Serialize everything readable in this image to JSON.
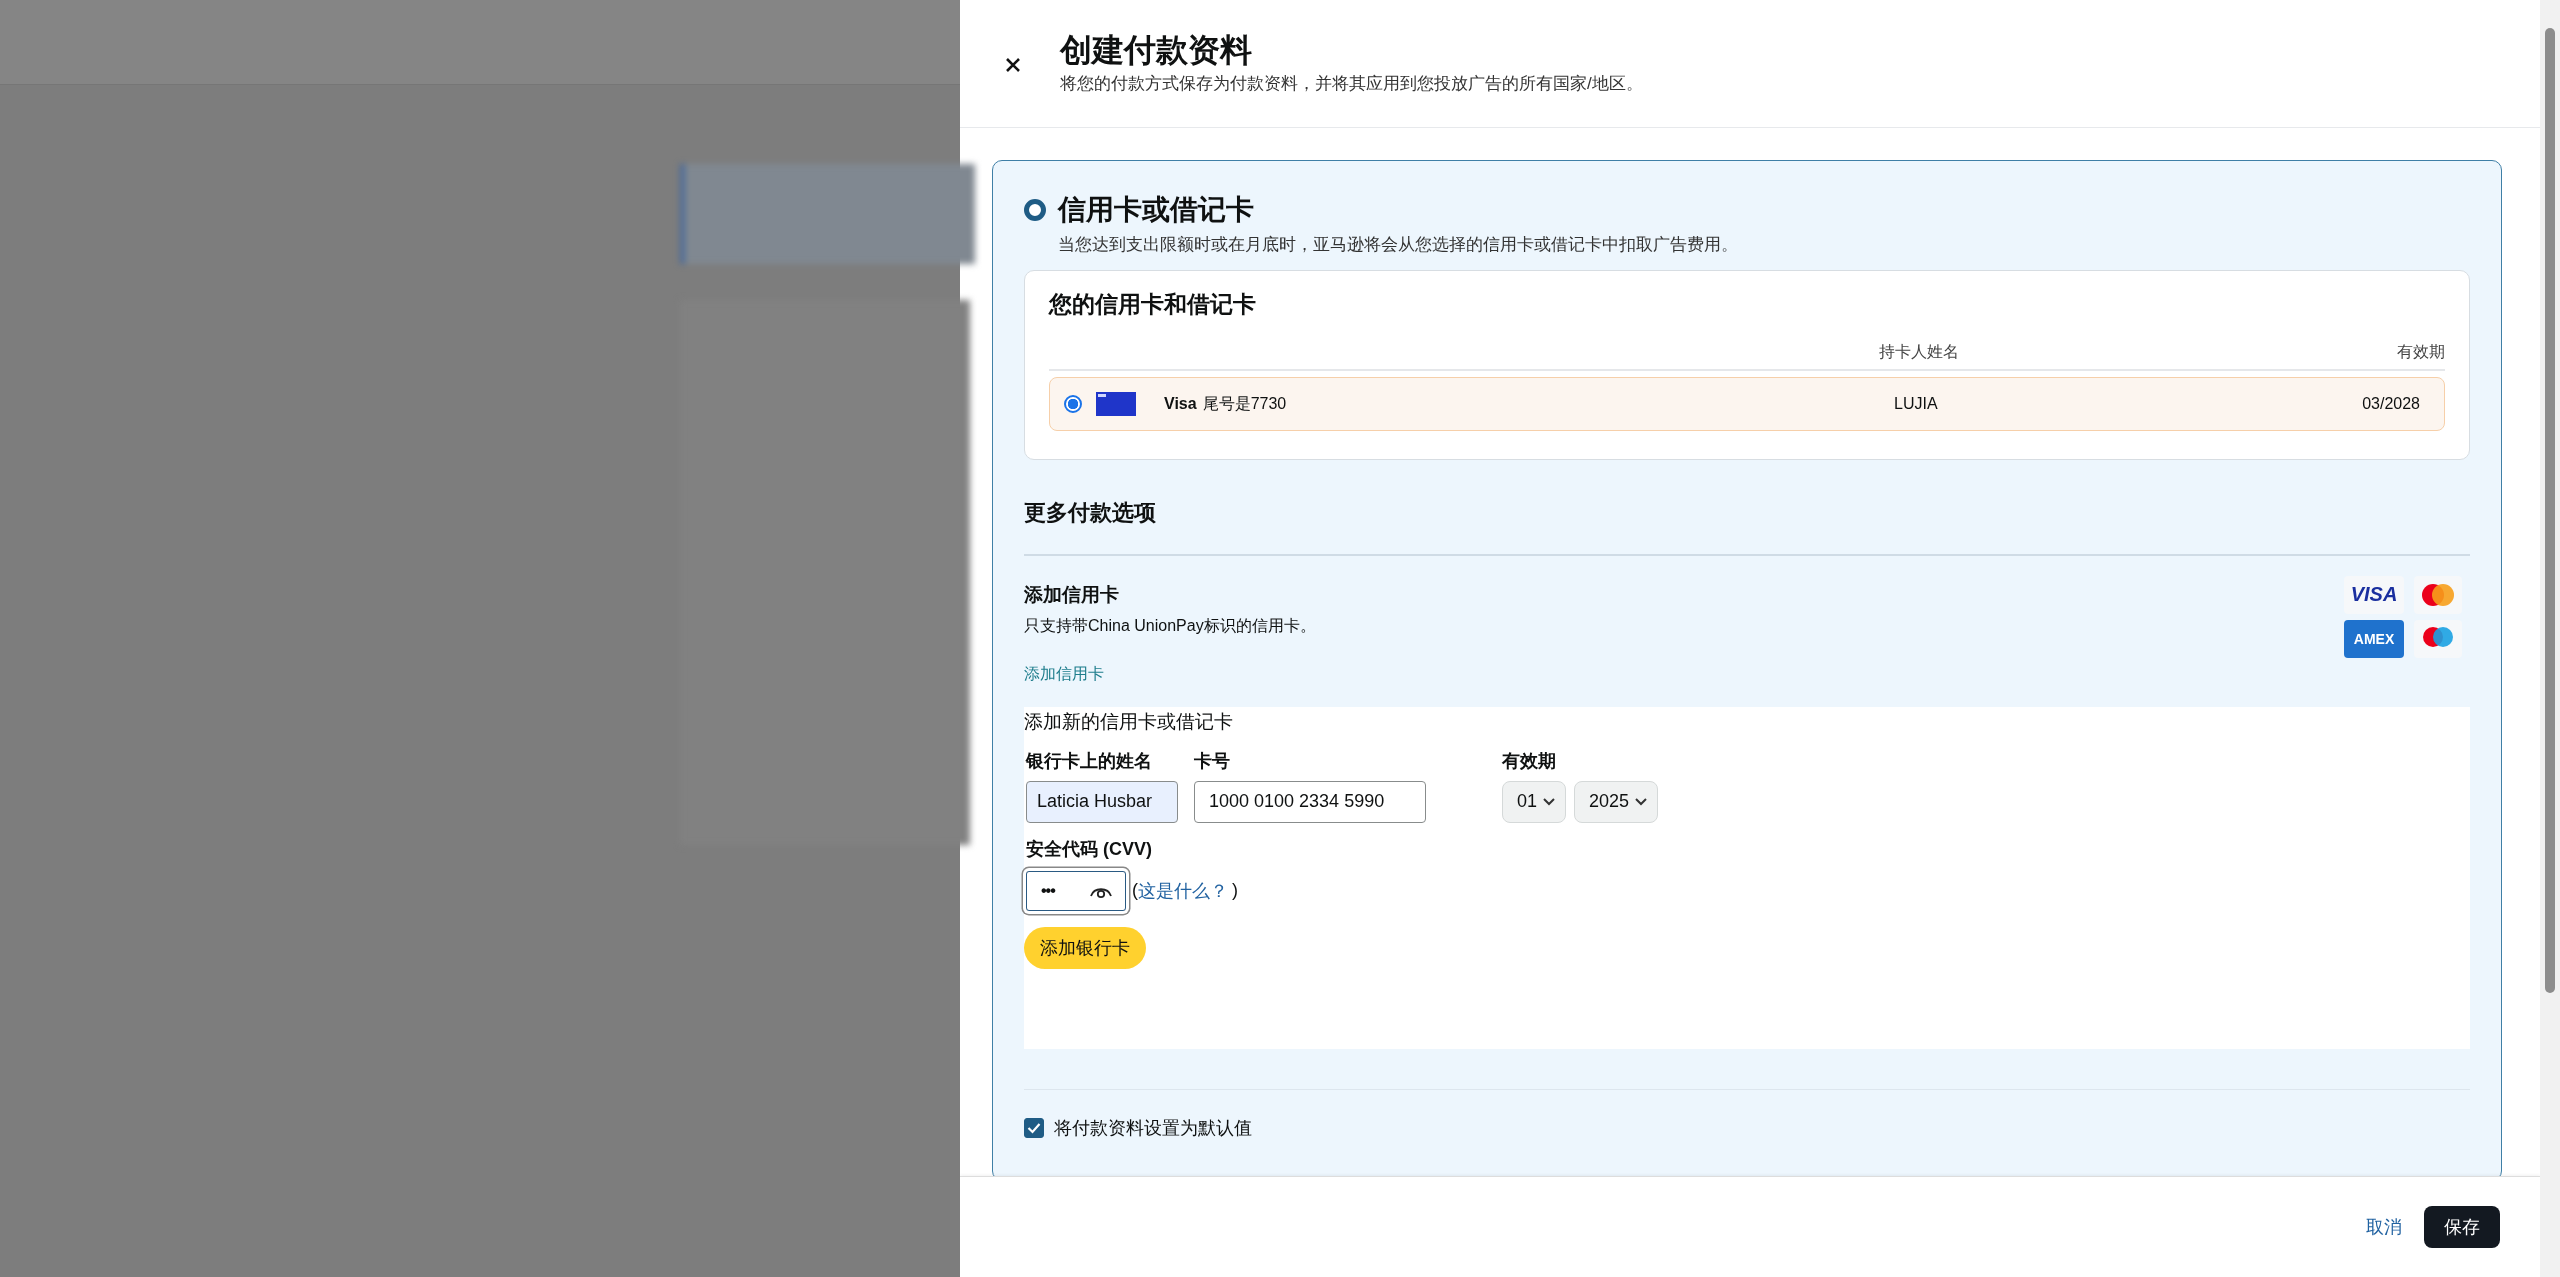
{
  "panel": {
    "title": "创建付款资料",
    "subtitle": "将您的付款方式保存为付款资料，并将其应用到您投放广告的所有国家/地区。"
  },
  "payment_method": {
    "label": "信用卡或借记卡",
    "selected": true,
    "description": "当您达到支出限额时或在月底时，亚马逊将会从您选择的信用卡或借记卡中扣取广告费用。"
  },
  "saved_cards": {
    "title": "您的信用卡和借记卡",
    "columns": [
      "持卡人姓名",
      "有效期"
    ],
    "rows": [
      {
        "selected": true,
        "brand": "Visa",
        "ending": "尾号是7730",
        "holder": "LUJIA",
        "expiry": "03/2028"
      }
    ]
  },
  "more_options": {
    "title": "更多付款选项",
    "add_card_title": "添加信用卡",
    "note": "只支持带China UnionPay标识的信用卡。",
    "link": "添加信用卡",
    "card_logos": [
      {
        "kind": "visa",
        "text": "VISA"
      },
      {
        "kind": "mastercard"
      },
      {
        "kind": "amex",
        "text": "AMEX"
      },
      {
        "kind": "maestro"
      }
    ]
  },
  "new_card_form": {
    "title": "添加新的信用卡或借记卡",
    "name_label": "银行卡上的姓名",
    "name_value": "Laticia Husbar",
    "number_label": "卡号",
    "number_value": "1000 0100 2334 5990",
    "expiry_label": "有效期",
    "month": "01",
    "year": "2025",
    "cvv_label": "安全代码 (CVV)",
    "cvv_value": "•••",
    "help_open": "(",
    "help_link": "这是什么？",
    "help_close": ")",
    "submit": "添加银行卡"
  },
  "default_checkbox": {
    "label": "将付款资料设置为默认值",
    "checked": true
  },
  "footer": {
    "cancel": "取消",
    "save": "保存"
  }
}
